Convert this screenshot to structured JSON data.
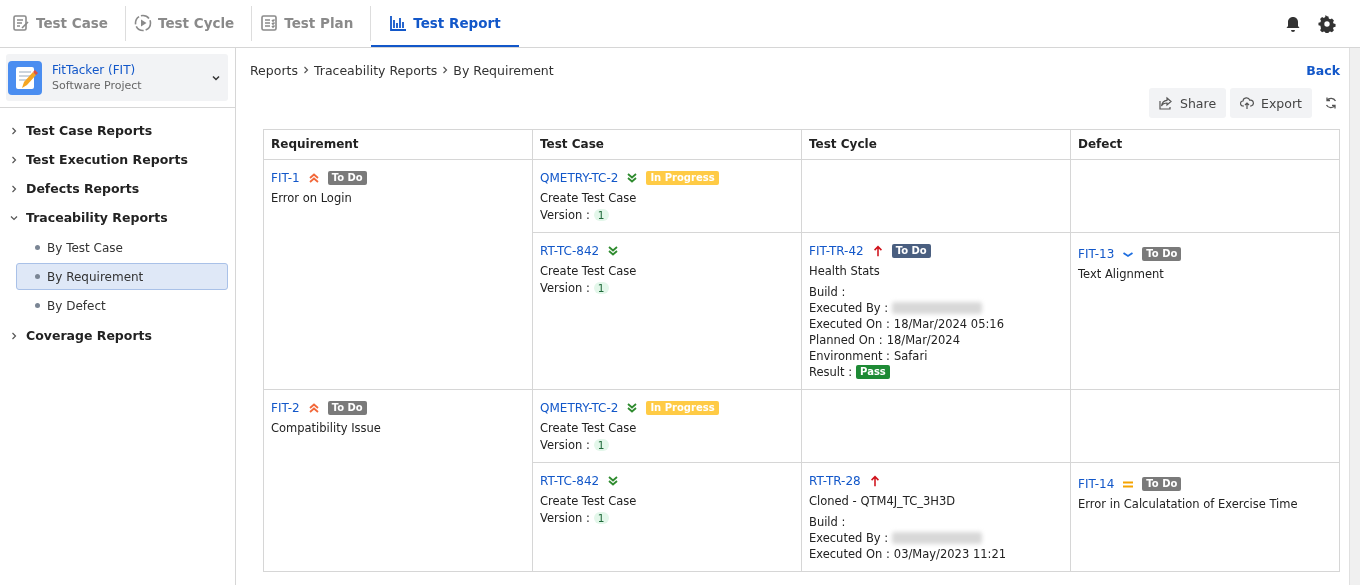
{
  "nav": {
    "tabs": [
      {
        "label": "Test Case",
        "kind": "case",
        "selected": false
      },
      {
        "label": "Test Cycle",
        "kind": "cycle",
        "selected": false
      },
      {
        "label": "Test Plan",
        "kind": "plan",
        "selected": false
      },
      {
        "label": "Test Report",
        "kind": "report",
        "selected": true
      }
    ]
  },
  "sidebar": {
    "project": {
      "name": "FitTacker (FIT)",
      "type": "Software Project"
    },
    "items": [
      {
        "label": "Test Case Reports",
        "expanded": false
      },
      {
        "label": "Test Execution Reports",
        "expanded": false
      },
      {
        "label": "Defects Reports",
        "expanded": false
      },
      {
        "label": "Traceability Reports",
        "expanded": true,
        "children": [
          {
            "label": "By Test Case",
            "selected": false
          },
          {
            "label": "By Requirement",
            "selected": true
          },
          {
            "label": "By Defect",
            "selected": false
          }
        ]
      },
      {
        "label": "Coverage Reports",
        "expanded": false
      }
    ]
  },
  "breadcrumb": [
    "Reports",
    "Traceability Reports",
    "By Requirement"
  ],
  "back": "Back",
  "actions": [
    {
      "label": "Share",
      "kind": "share"
    },
    {
      "label": "Export",
      "kind": "export"
    }
  ],
  "table": {
    "columns": [
      "Requirement",
      "Test Case",
      "Test Cycle",
      "Defect"
    ],
    "rows": [
      {
        "key": "FIT-1",
        "kind": "highest",
        "status": {
          "label": "To Do",
          "color": "#7a7a7a"
        },
        "title": "Error on Login",
        "links": [
          {
            "test_case": {
              "key": "QMETRY-TC-2",
              "kind": "lowest",
              "status": {
                "label": "In Progress",
                "color": "#ffcb45"
              },
              "title": "Create Test Case",
              "version_label": "Version :",
              "version": "1"
            }
          },
          {
            "test_case": {
              "key": "RT-TC-842",
              "kind": "lowest",
              "title": "Create Test Case",
              "version_label": "Version :",
              "version": "1"
            },
            "test_cycle": {
              "key": "FIT-TR-42",
              "kind": "high",
              "status": {
                "label": "To Do",
                "color": "#4a5f80"
              },
              "title": "Health Stats",
              "details": [
                {
                  "label": "Build :",
                  "redacted": false
                },
                {
                  "label": "Executed By :",
                  "redacted": true
                },
                {
                  "label": "Executed On :",
                  "value": "18/Mar/2024 05:16",
                  "redacted": false
                },
                {
                  "label": "Planned On :",
                  "value": "18/Mar/2024",
                  "redacted": false
                },
                {
                  "label": "Environment :",
                  "value": "Safari",
                  "redacted": false
                },
                {
                  "label": "Result :",
                  "badge": {
                    "label": "Pass",
                    "color": "#1e8a35"
                  },
                  "redacted": false
                }
              ]
            },
            "defect": {
              "key": "FIT-13",
              "kind": "low",
              "status": {
                "label": "To Do",
                "color": "#7a7a7a"
              },
              "title": "Text Alignment"
            }
          }
        ]
      },
      {
        "key": "FIT-2",
        "kind": "highest",
        "status": {
          "label": "To Do",
          "color": "#7a7a7a"
        },
        "title": "Compatibility Issue",
        "links": [
          {
            "test_case": {
              "key": "QMETRY-TC-2",
              "kind": "lowest",
              "status": {
                "label": "In Progress",
                "color": "#ffcb45"
              },
              "title": "Create Test Case",
              "version_label": "Version :",
              "version": "1"
            }
          },
          {
            "test_case": {
              "key": "RT-TC-842",
              "kind": "lowest",
              "title": "Create Test Case",
              "version_label": "Version :",
              "version": "1"
            },
            "test_cycle": {
              "key": "RT-TR-28",
              "kind": "high",
              "title": "Cloned - QTM4J_TC_3H3D",
              "details": [
                {
                  "label": "Build :",
                  "redacted": false
                },
                {
                  "label": "Executed By :",
                  "redacted": true
                },
                {
                  "label": "Executed On :",
                  "value": "03/May/2023 11:21",
                  "redacted": false
                }
              ]
            },
            "defect": {
              "key": "FIT-14",
              "kind": "medium",
              "status": {
                "label": "To Do",
                "color": "#7a7a7a"
              },
              "title": "Error in Calculatation of Exercise Time"
            }
          }
        ]
      }
    ]
  }
}
